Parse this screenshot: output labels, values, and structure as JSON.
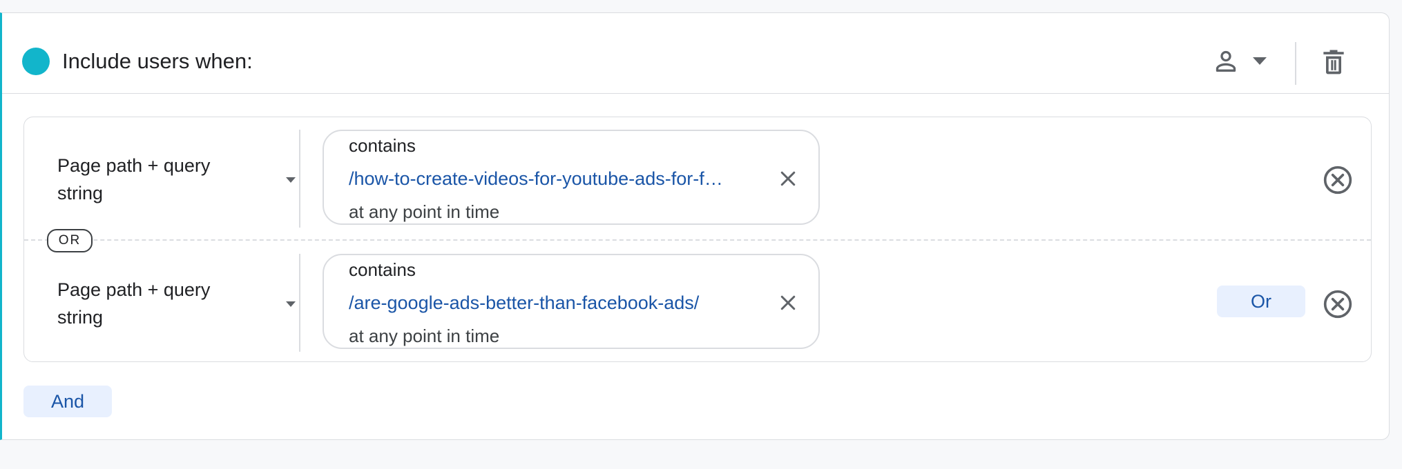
{
  "header": {
    "title": "Include users when:",
    "accent_color": "#12b5cb",
    "scope_icon": "person-icon",
    "delete_icon": "trash-icon"
  },
  "conditions": [
    {
      "dimension": "Page path + query string",
      "operator": "contains",
      "value": "/how-to-create-videos-for-youtube-ads-for-f…",
      "time": "at any point in time"
    },
    {
      "dimension": "Page path + query string",
      "operator": "contains",
      "value": "/are-google-ads-better-than-facebook-ads/",
      "time": "at any point in time"
    }
  ],
  "separator_label": "OR",
  "or_button_label": "Or",
  "and_button_label": "And",
  "colors": {
    "link": "#1a55a7",
    "button_bg": "#e8f0fe",
    "border": "#dadce0"
  }
}
